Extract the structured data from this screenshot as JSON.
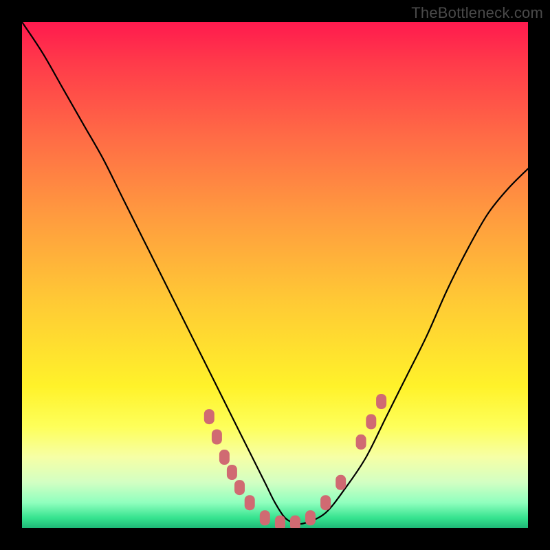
{
  "watermark": "TheBottleneck.com",
  "colors": {
    "frame_background": "#000000",
    "curve_stroke": "#000000",
    "marker_fill": "#d06a72",
    "gradient_top": "#ff1a4e",
    "gradient_bottom": "#1fb877"
  },
  "chart_data": {
    "type": "line",
    "title": "",
    "xlabel": "",
    "ylabel": "",
    "xlim": [
      0,
      100
    ],
    "ylim": [
      0,
      100
    ],
    "grid": false,
    "note": "Chart has no visible tick labels or axis labels; x is normalized 0–100 left→right, y is 0 at bottom, 100 at top. Curve y-values are estimated from pixel positions relative to plot area.",
    "series": [
      {
        "name": "bottleneck-curve",
        "x": [
          0,
          4,
          8,
          12,
          16,
          20,
          24,
          28,
          32,
          36,
          40,
          44,
          48,
          50,
          52,
          54,
          56,
          60,
          64,
          68,
          72,
          76,
          80,
          84,
          88,
          92,
          96,
          100
        ],
        "y": [
          100,
          94,
          87,
          80,
          73,
          65,
          57,
          49,
          41,
          33,
          25,
          17,
          9,
          5,
          2,
          1,
          1,
          3,
          8,
          14,
          22,
          30,
          38,
          47,
          55,
          62,
          67,
          71
        ]
      }
    ],
    "markers": {
      "name": "highlighted-points",
      "note": "Rounded pink markers clustered near the valley and along lower slopes, y≈0 corresponds to bottom edge.",
      "points": [
        {
          "x": 37,
          "y": 22
        },
        {
          "x": 38.5,
          "y": 18
        },
        {
          "x": 40,
          "y": 14
        },
        {
          "x": 41.5,
          "y": 11
        },
        {
          "x": 43,
          "y": 8
        },
        {
          "x": 45,
          "y": 5
        },
        {
          "x": 48,
          "y": 2
        },
        {
          "x": 51,
          "y": 1
        },
        {
          "x": 54,
          "y": 1
        },
        {
          "x": 57,
          "y": 2
        },
        {
          "x": 60,
          "y": 5
        },
        {
          "x": 63,
          "y": 9
        },
        {
          "x": 67,
          "y": 17
        },
        {
          "x": 69,
          "y": 21
        },
        {
          "x": 71,
          "y": 25
        }
      ]
    }
  }
}
